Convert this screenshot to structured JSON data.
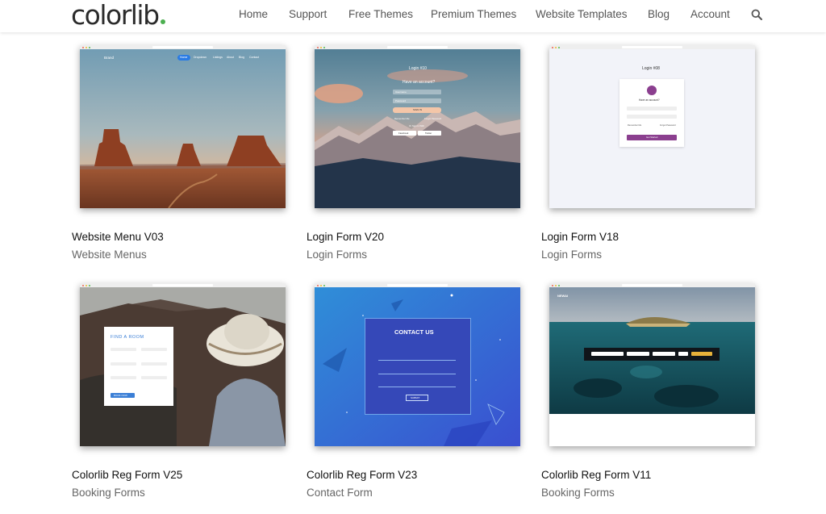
{
  "header": {
    "logo_text": "colorlib",
    "logo_dot_color": "#4caf50",
    "nav": [
      "Home",
      "Support",
      "Free Themes",
      "Premium Themes",
      "Website Templates",
      "Blog",
      "Account"
    ],
    "search_icon": "search-icon"
  },
  "cards": [
    {
      "title": "Website Menu V03",
      "category": "Website Menus",
      "thumb": {
        "brand": "Brand",
        "menu": [
          "Home",
          "Dropdown",
          "Listings",
          "About",
          "Blog",
          "Contact"
        ]
      }
    },
    {
      "title": "Login Form V20",
      "category": "Login Forms",
      "thumb": {
        "heading": "Login #10",
        "subheading": "Have an account?",
        "username": "Username",
        "password": "Password",
        "button": "SIGN IN",
        "remember": "Remember Me",
        "forgot": "Forgot Password",
        "or": "Or Sign In With",
        "social": [
          "Facebook",
          "Twitter"
        ]
      }
    },
    {
      "title": "Login Form V18",
      "category": "Login Forms",
      "thumb": {
        "heading": "Login #08",
        "subheading": "Have an account?",
        "remember": "Remember Me",
        "forgot": "Forgot Password",
        "button": "Get Started"
      }
    },
    {
      "title": "Colorlib Reg Form V25",
      "category": "Booking Forms",
      "thumb": {
        "heading": "FIND A ROOM",
        "button": "BOOK NOW"
      }
    },
    {
      "title": "Colorlib Reg Form V23",
      "category": "Contact Form",
      "thumb": {
        "heading": "CONTACT US",
        "button": "SUBMIT"
      }
    },
    {
      "title": "Colorlib Reg Form V11",
      "category": "Booking Forms",
      "thumb": {
        "brand": "NEWAI"
      }
    }
  ]
}
